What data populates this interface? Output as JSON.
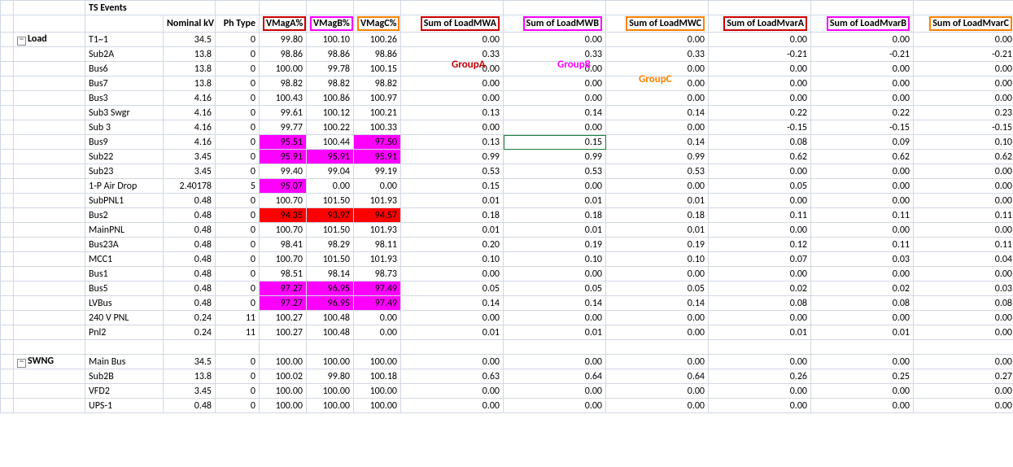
{
  "headers": {
    "col0": "",
    "ts_title": "TS Events",
    "nominal": "Nominal kV",
    "phtype": "Ph Type",
    "vmaga": "VMagA%",
    "vmagb": "VMagB%",
    "vmagc": "VMagC%",
    "mw_a": "Sum of LoadMWA",
    "mw_b": "Sum of LoadMWB",
    "mw_c": "Sum of LoadMWC",
    "mv_a": "Sum of LoadMvarA",
    "mv_b": "Sum of LoadMvarB",
    "mv_c": "Sum of LoadMvarC"
  },
  "group_labels": {
    "a": "GroupA",
    "b": "GroupB",
    "c": "GroupC"
  },
  "sections": [
    {
      "name": "Load",
      "rows": [
        {
          "name": "T1~1",
          "nom": "34.5",
          "ph": "0",
          "va": "99.80",
          "vb": "100.10",
          "vc": "100.26",
          "mwa": "0.00",
          "mwb": "0.00",
          "mwc": "0.00",
          "mva": "0.00",
          "mvb": "0.00",
          "mvc": "0.00"
        },
        {
          "name": "Sub2A",
          "nom": "13.8",
          "ph": "0",
          "va": "98.86",
          "vb": "98.86",
          "vc": "98.86",
          "mwa": "0.33",
          "mwb": "0.33",
          "mwc": "0.33",
          "mva": "-0.21",
          "mvb": "-0.21",
          "mvc": "-0.21"
        },
        {
          "name": "Bus6",
          "nom": "13.8",
          "ph": "0",
          "va": "100.00",
          "vb": "99.78",
          "vc": "100.15",
          "mwa": "0.00",
          "mwb": "0.00",
          "mwc": "0.00",
          "mva": "0.00",
          "mvb": "0.00",
          "mvc": "0.00"
        },
        {
          "name": "Bus7",
          "nom": "13.8",
          "ph": "0",
          "va": "98.82",
          "vb": "98.82",
          "vc": "98.82",
          "mwa": "0.00",
          "mwb": "0.00",
          "mwc": "0.00",
          "mva": "0.00",
          "mvb": "0.00",
          "mvc": "0.00"
        },
        {
          "name": "Bus3",
          "nom": "4.16",
          "ph": "0",
          "va": "100.43",
          "vb": "100.86",
          "vc": "100.97",
          "mwa": "0.00",
          "mwb": "0.00",
          "mwc": "0.00",
          "mva": "0.00",
          "mvb": "0.00",
          "mvc": "0.00"
        },
        {
          "name": "Sub3 Swgr",
          "nom": "4.16",
          "ph": "0",
          "va": "99.61",
          "vb": "100.12",
          "vc": "100.21",
          "mwa": "0.13",
          "mwb": "0.14",
          "mwc": "0.14",
          "mva": "0.22",
          "mvb": "0.22",
          "mvc": "0.23"
        },
        {
          "name": "Sub 3",
          "nom": "4.16",
          "ph": "0",
          "va": "99.77",
          "vb": "100.22",
          "vc": "100.33",
          "mwa": "0.00",
          "mwb": "0.00",
          "mwc": "0.00",
          "mva": "-0.15",
          "mvb": "-0.15",
          "mvc": "-0.15"
        },
        {
          "name": "Bus9",
          "nom": "4.16",
          "ph": "0",
          "va": "95.51",
          "vb": "100.44",
          "vc": "97.50",
          "mwa": "0.13",
          "mwb": "0.15",
          "mwc": "0.14",
          "mva": "0.08",
          "mvb": "0.09",
          "mvc": "0.10",
          "hl": {
            "va": "magenta",
            "vc": "magenta"
          },
          "selected": "mwb"
        },
        {
          "name": "Sub22",
          "nom": "3.45",
          "ph": "0",
          "va": "95.91",
          "vb": "95.91",
          "vc": "95.91",
          "mwa": "0.99",
          "mwb": "0.99",
          "mwc": "0.99",
          "mva": "0.62",
          "mvb": "0.62",
          "mvc": "0.62",
          "hl": {
            "va": "magenta",
            "vb": "magenta",
            "vc": "magenta"
          }
        },
        {
          "name": "Sub23",
          "nom": "3.45",
          "ph": "0",
          "va": "99.40",
          "vb": "99.04",
          "vc": "99.19",
          "mwa": "0.53",
          "mwb": "0.53",
          "mwc": "0.53",
          "mva": "0.00",
          "mvb": "0.00",
          "mvc": "0.00"
        },
        {
          "name": "1-P Air Drop",
          "nom": "2.40178",
          "ph": "5",
          "va": "95.07",
          "vb": "0.00",
          "vc": "0.00",
          "mwa": "0.15",
          "mwb": "0.00",
          "mwc": "0.00",
          "mva": "0.05",
          "mvb": "0.00",
          "mvc": "0.00",
          "hl": {
            "va": "magenta"
          }
        },
        {
          "name": "SubPNL1",
          "nom": "0.48",
          "ph": "0",
          "va": "100.70",
          "vb": "101.50",
          "vc": "101.93",
          "mwa": "0.01",
          "mwb": "0.01",
          "mwc": "0.01",
          "mva": "0.00",
          "mvb": "0.00",
          "mvc": "0.00"
        },
        {
          "name": "Bus2",
          "nom": "0.48",
          "ph": "0",
          "va": "94.35",
          "vb": "93.97",
          "vc": "94.57",
          "mwa": "0.18",
          "mwb": "0.18",
          "mwc": "0.18",
          "mva": "0.11",
          "mvb": "0.11",
          "mvc": "0.11",
          "hl": {
            "va": "red",
            "vb": "red",
            "vc": "red"
          }
        },
        {
          "name": "MainPNL",
          "nom": "0.48",
          "ph": "0",
          "va": "100.70",
          "vb": "101.50",
          "vc": "101.93",
          "mwa": "0.01",
          "mwb": "0.01",
          "mwc": "0.01",
          "mva": "0.00",
          "mvb": "0.00",
          "mvc": "0.00"
        },
        {
          "name": "Bus23A",
          "nom": "0.48",
          "ph": "0",
          "va": "98.41",
          "vb": "98.29",
          "vc": "98.11",
          "mwa": "0.20",
          "mwb": "0.19",
          "mwc": "0.19",
          "mva": "0.12",
          "mvb": "0.11",
          "mvc": "0.11"
        },
        {
          "name": "MCC1",
          "nom": "0.48",
          "ph": "0",
          "va": "100.70",
          "vb": "101.50",
          "vc": "101.93",
          "mwa": "0.10",
          "mwb": "0.10",
          "mwc": "0.10",
          "mva": "0.07",
          "mvb": "0.03",
          "mvc": "0.04"
        },
        {
          "name": "Bus1",
          "nom": "0.48",
          "ph": "0",
          "va": "98.51",
          "vb": "98.14",
          "vc": "98.73",
          "mwa": "0.00",
          "mwb": "0.00",
          "mwc": "0.00",
          "mva": "0.00",
          "mvb": "0.00",
          "mvc": "0.00"
        },
        {
          "name": "Bus5",
          "nom": "0.48",
          "ph": "0",
          "va": "97.27",
          "vb": "96.95",
          "vc": "97.49",
          "mwa": "0.05",
          "mwb": "0.05",
          "mwc": "0.05",
          "mva": "0.02",
          "mvb": "0.02",
          "mvc": "0.03",
          "hl": {
            "va": "magenta",
            "vb": "magenta",
            "vc": "magenta"
          }
        },
        {
          "name": "LVBus",
          "nom": "0.48",
          "ph": "0",
          "va": "97.27",
          "vb": "96.95",
          "vc": "97.49",
          "mwa": "0.14",
          "mwb": "0.14",
          "mwc": "0.14",
          "mva": "0.08",
          "mvb": "0.08",
          "mvc": "0.08",
          "hl": {
            "va": "magenta",
            "vb": "magenta",
            "vc": "magenta"
          }
        },
        {
          "name": "240 V PNL",
          "nom": "0.24",
          "ph": "11",
          "va": "100.27",
          "vb": "100.48",
          "vc": "0.00",
          "mwa": "0.00",
          "mwb": "0.00",
          "mwc": "0.00",
          "mva": "0.00",
          "mvb": "0.00",
          "mvc": "0.00"
        },
        {
          "name": "Pnl2",
          "nom": "0.24",
          "ph": "11",
          "va": "100.27",
          "vb": "100.48",
          "vc": "0.00",
          "mwa": "0.01",
          "mwb": "0.01",
          "mwc": "0.00",
          "mva": "0.01",
          "mvb": "0.01",
          "mvc": "0.00"
        }
      ]
    },
    {
      "name": "SWNG",
      "rows": [
        {
          "name": "Main Bus",
          "nom": "34.5",
          "ph": "0",
          "va": "100.00",
          "vb": "100.00",
          "vc": "100.00",
          "mwa": "0.00",
          "mwb": "0.00",
          "mwc": "0.00",
          "mva": "0.00",
          "mvb": "0.00",
          "mvc": "0.00"
        },
        {
          "name": "Sub2B",
          "nom": "13.8",
          "ph": "0",
          "va": "100.02",
          "vb": "99.80",
          "vc": "100.18",
          "mwa": "0.63",
          "mwb": "0.64",
          "mwc": "0.64",
          "mva": "0.26",
          "mvb": "0.25",
          "mvc": "0.27"
        },
        {
          "name": "VFD2",
          "nom": "3.45",
          "ph": "0",
          "va": "100.00",
          "vb": "100.00",
          "vc": "100.00",
          "mwa": "0.00",
          "mwb": "0.00",
          "mwc": "0.00",
          "mva": "0.00",
          "mvb": "0.00",
          "mvc": "0.00"
        },
        {
          "name": "UPS-1",
          "nom": "0.48",
          "ph": "0",
          "va": "100.00",
          "vb": "100.00",
          "vc": "100.00",
          "mwa": "0.00",
          "mwb": "0.00",
          "mwc": "0.00",
          "mva": "0.00",
          "mvb": "0.00",
          "mvc": "0.00"
        }
      ]
    }
  ]
}
